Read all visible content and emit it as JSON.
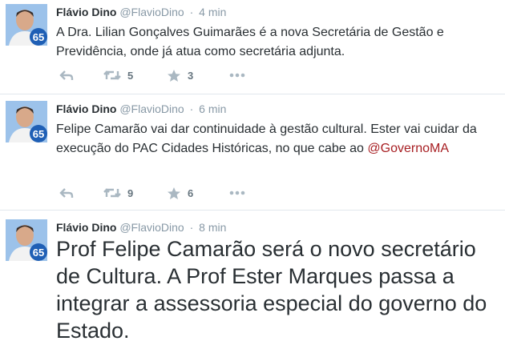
{
  "tweets": [
    {
      "name": "Flávio Dino",
      "handle": "@FlavioDino",
      "sep": "·",
      "time": "4 min",
      "text": "A Dra. Lilian Gonçalves Guimarães é a nova Secretária de Gestão e Previdência, onde já atua como secretária adjunta.",
      "retweets": "5",
      "favorites": "3",
      "avatar_badge": "65"
    },
    {
      "name": "Flávio Dino",
      "handle": "@FlavioDino",
      "sep": "·",
      "time": "6 min",
      "text": "Felipe Camarão vai dar continuidade à gestão cultural. Ester vai cuidar da execução do PAC Cidades Históricas, no que cabe ao ",
      "mention": "@GovernoMA",
      "retweets": "9",
      "favorites": "6",
      "avatar_badge": "65"
    },
    {
      "name": "Flávio Dino",
      "handle": "@FlavioDino",
      "sep": "·",
      "time": "8 min",
      "text": "Prof Felipe Camarão será o novo secretário de Cultura. A Prof Ester Marques passa a integrar a assessoria especial do governo do Estado.",
      "avatar_badge": "65"
    }
  ],
  "icons": {
    "reply": "reply-icon",
    "retweet": "retweet-icon",
    "favorite": "star-icon",
    "more": "more-icon"
  },
  "colors": {
    "name": "#292f33",
    "meta": "#8899a6",
    "mention": "#a71e22",
    "divider": "#e1e8ed",
    "badge": "#1f5fb5"
  }
}
